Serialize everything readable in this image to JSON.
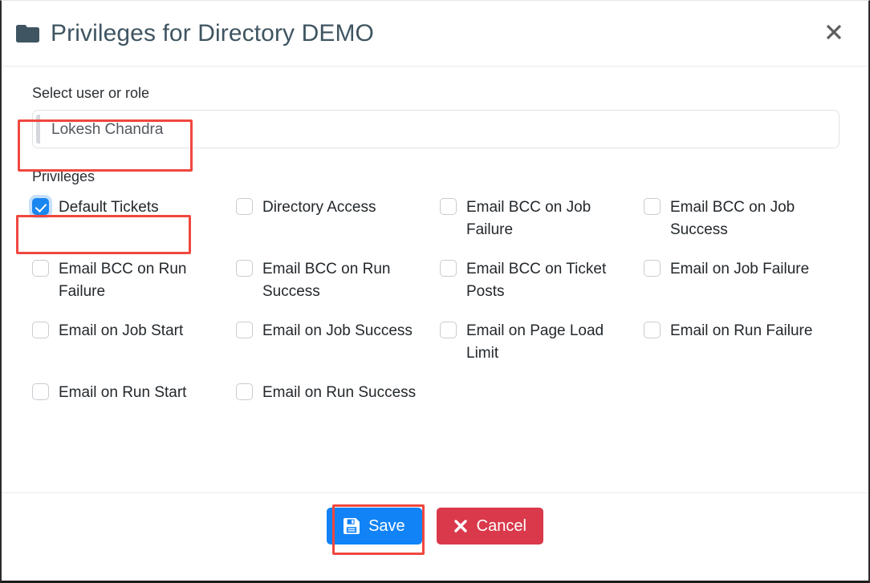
{
  "header": {
    "title": "Privileges for Directory DEMO",
    "folder_icon": "folder-icon",
    "close_icon": "close-icon",
    "title_color": "#3f5561"
  },
  "form": {
    "select_label": "Select user or role",
    "selected_user": "Lokesh Chandra",
    "select_placeholder": "Select user or role",
    "privileges_label": "Privileges"
  },
  "privileges": [
    {
      "label": "Default Tickets",
      "checked": true
    },
    {
      "label": "Directory Access",
      "checked": false
    },
    {
      "label": "Email BCC on Job Failure",
      "checked": false
    },
    {
      "label": "Email BCC on Job Success",
      "checked": false
    },
    {
      "label": "Email BCC on Run Failure",
      "checked": false
    },
    {
      "label": "Email BCC on Run Success",
      "checked": false
    },
    {
      "label": "Email BCC on Ticket Posts",
      "checked": false
    },
    {
      "label": "Email on Job Failure",
      "checked": false
    },
    {
      "label": "Email on Job Start",
      "checked": false
    },
    {
      "label": "Email on Job Success",
      "checked": false
    },
    {
      "label": "Email on Page Load Limit",
      "checked": false
    },
    {
      "label": "Email on Run Failure",
      "checked": false
    },
    {
      "label": "Email on Run Start",
      "checked": false
    },
    {
      "label": "Email on Run Success",
      "checked": false
    }
  ],
  "footer": {
    "save_label": "Save",
    "save_icon": "floppy-disk-save-icon",
    "save_color": "#1183f7",
    "cancel_label": "Cancel",
    "cancel_icon": "times-x-icon",
    "cancel_color": "#d9394b"
  },
  "annotations": {
    "color": "#f0473f",
    "boxes": [
      "select-user-field",
      "default-tickets-checkbox",
      "save-button"
    ]
  }
}
